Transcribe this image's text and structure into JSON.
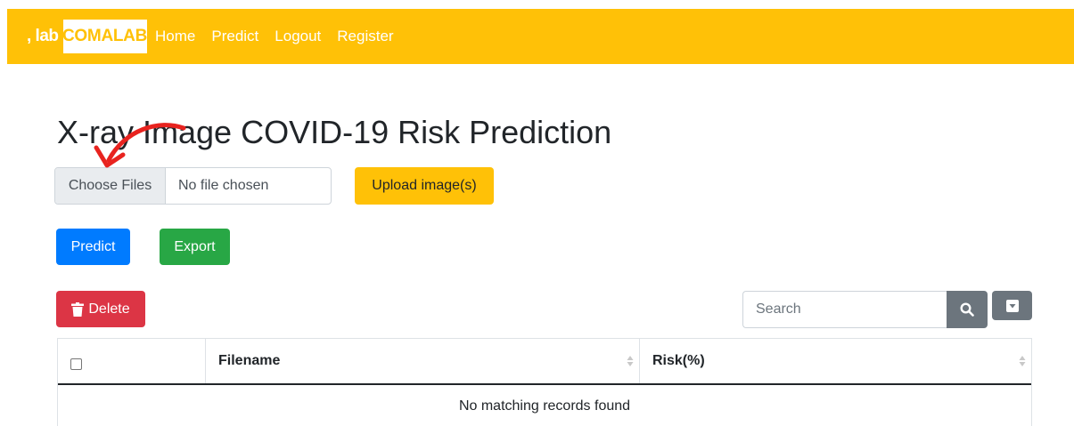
{
  "navbar": {
    "brand_prefix": ", lab",
    "brand_name": "COMALAB",
    "links": [
      "Home",
      "Predict",
      "Logout",
      "Register"
    ]
  },
  "main": {
    "title": "X-ray Image COVID-19 Risk Prediction",
    "file_input": {
      "button_label": "Choose Files",
      "status": "No file chosen"
    },
    "upload_label": "Upload image(s)",
    "predict_label": "Predict",
    "export_label": "Export",
    "delete_label": "Delete",
    "search": {
      "placeholder": "Search"
    },
    "table": {
      "columns": [
        "Filename",
        "Risk(%)"
      ],
      "empty_message": "No matching records found"
    }
  },
  "colors": {
    "navbar": "#ffc107",
    "primary": "#007bff",
    "success": "#28a745",
    "danger": "#dc3545",
    "secondary": "#6c757d",
    "annotation_arrow": "#e8231f"
  },
  "icons": [
    "trash-icon",
    "search-icon",
    "caret-down-icon",
    "sort-icon",
    "annotation-arrow"
  ]
}
